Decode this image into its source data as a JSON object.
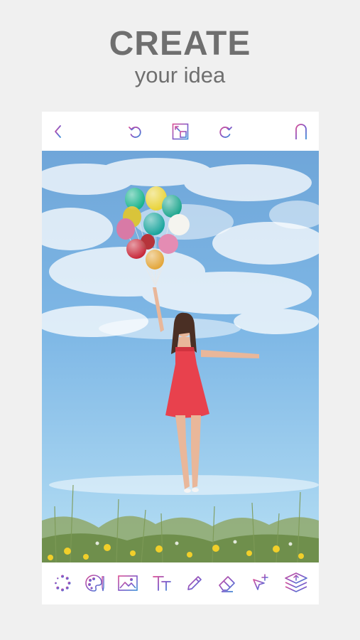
{
  "headline": {
    "title": "CREATE",
    "subtitle": "your idea"
  },
  "topbar": {
    "icons": [
      "back-chevron-icon",
      "undo-icon",
      "crop-resize-icon",
      "redo-icon",
      "magnet-icon"
    ]
  },
  "toolbar": {
    "icons": [
      "effects-dots-icon",
      "palette-brush-icon",
      "image-icon",
      "text-icon",
      "pencil-icon",
      "eraser-icon",
      "move-select-icon",
      "layers-icon"
    ]
  },
  "colors": {
    "background": "#f0f0f0",
    "title_text": "#6f6f6f",
    "icon_pink": "#d94f95",
    "icon_purple": "#7d58c9",
    "icon_blue": "#3d8fd6",
    "sky_top": "#6fa6d9",
    "sky_bottom": "#b6dff4",
    "dress": "#e8414d"
  }
}
